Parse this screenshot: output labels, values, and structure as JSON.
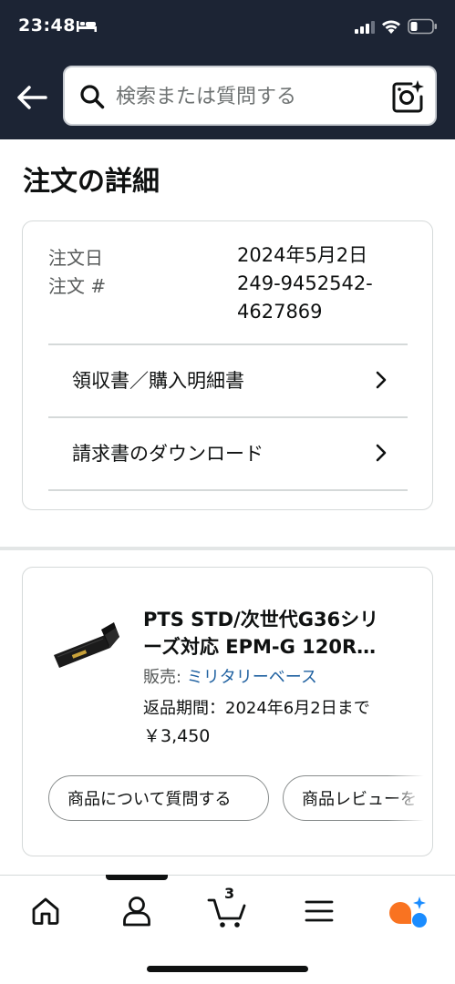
{
  "status_bar": {
    "time": "23:48"
  },
  "search": {
    "placeholder": "検索または質問する"
  },
  "page": {
    "title": "注文の詳細"
  },
  "order": {
    "date_label": "注文日",
    "date_value": "2024年5月2日",
    "number_label": "注文 #",
    "number_value_line1": "249-9452542-",
    "number_value_line2": "4627869",
    "links": [
      {
        "label": "領収書／購入明細書"
      },
      {
        "label": "請求書のダウンロード"
      }
    ]
  },
  "product": {
    "title_line1": "PTS STD/次世代G36シリ",
    "title_line2": "ーズ対応 EPM-G 120R…",
    "seller_label": "販売: ",
    "seller_name": "ミリタリーベース",
    "return_period": "返品期間：2024年6月2日まで",
    "price": "￥3,450",
    "actions": [
      {
        "label": "商品について質問する"
      },
      {
        "label": "商品レビューを"
      }
    ]
  },
  "bottom_nav": {
    "items": [
      {
        "icon": "home-icon"
      },
      {
        "icon": "account-icon"
      },
      {
        "icon": "cart-icon",
        "count": "3"
      },
      {
        "icon": "menu-icon"
      },
      {
        "icon": "rufus-assistant-icon"
      }
    ]
  },
  "colors": {
    "header_bg": "#1c2434",
    "link_blue": "#2162a1",
    "assistant_orange": "#f97321",
    "assistant_blue": "#1a8cff"
  }
}
